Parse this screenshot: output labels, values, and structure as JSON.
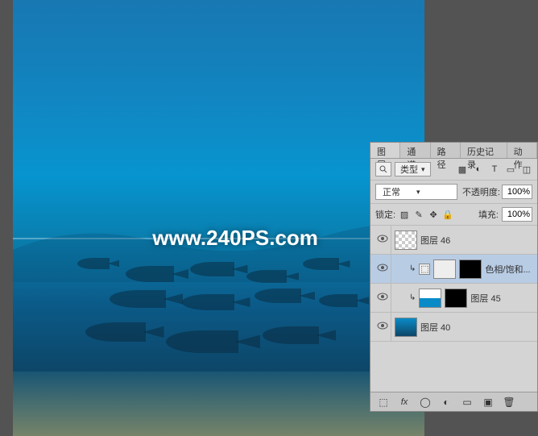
{
  "watermark": "www.240PS.com",
  "tabs": {
    "layers": "图层",
    "channels": "通道",
    "paths": "路径",
    "history": "历史记录",
    "actions": "动作"
  },
  "filter": {
    "type_label": "类型"
  },
  "blend": {
    "mode": "正常",
    "opacity_label": "不透明度:",
    "opacity_value": "100%"
  },
  "lock": {
    "label": "锁定:",
    "fill_label": "填充:",
    "fill_value": "100%"
  },
  "layers": [
    {
      "name": "图层 46"
    },
    {
      "name": "色相/饱和..."
    },
    {
      "name": "图层 45"
    },
    {
      "name": "图层 40"
    }
  ],
  "icons": {
    "link": "⬚",
    "fx": "fx",
    "mask": "◯",
    "adjust": "◐",
    "group": "▭",
    "new": "▣",
    "trash": "🗑"
  }
}
